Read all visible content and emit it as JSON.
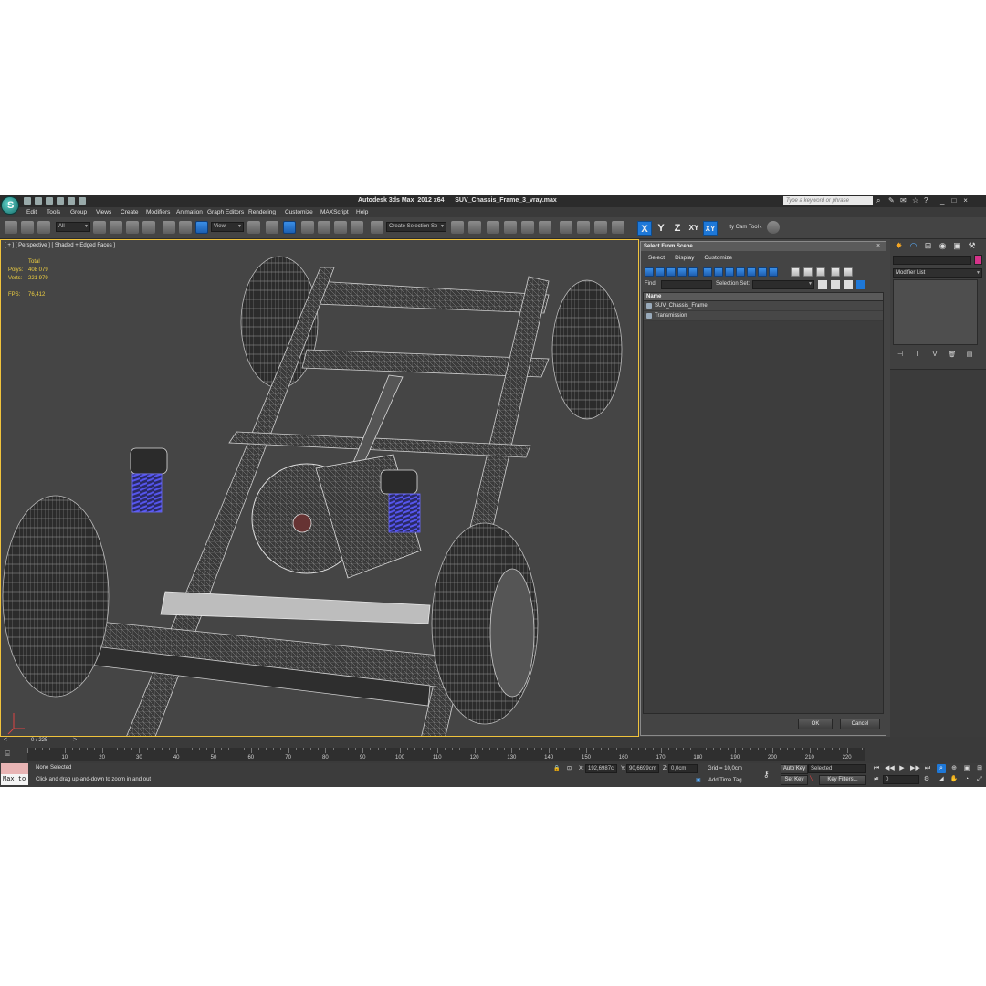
{
  "title": {
    "app_name": "Autodesk 3ds Max  2012 x64",
    "file_name": "SUV_Chassis_Frame_3_vray.max",
    "search_placeholder": "Type a keyword or phrase"
  },
  "menu": [
    "Edit",
    "Tools",
    "Group",
    "Views",
    "Create",
    "Modifiers",
    "Animation",
    "Graph Editors",
    "Rendering",
    "Customize",
    "MAXScript",
    "Help"
  ],
  "toolbar": {
    "selection_filter": "All",
    "ref_coord": "View",
    "named_selection": "Create Selection Se",
    "axes": [
      "X",
      "Y",
      "Z",
      "XY",
      "XY"
    ],
    "tool_label": "ity Cam Tool ‹"
  },
  "viewport": {
    "label": "[ + ] [ Perspective ] [ Shaded + Edged Faces ]",
    "stats": {
      "total_label": "Total",
      "polys_label": "Polys:",
      "polys_value": "408 079",
      "verts_label": "Verts:",
      "verts_value": "221 979",
      "fps_label": "FPS:",
      "fps_value": "76,412"
    }
  },
  "select_dialog": {
    "title": "Select From Scene",
    "menu": [
      "Select",
      "Display",
      "Customize"
    ],
    "find_label": "Find:",
    "selection_set_label": "Selection Set:",
    "column_header": "Name",
    "rows": [
      "SUV_Chassis_Frame",
      "Transmission"
    ],
    "ok_label": "OK",
    "cancel_label": "Cancel"
  },
  "command_panel": {
    "modifier_list": "Modifier List",
    "object_color": "#d6338a"
  },
  "timeline": {
    "frame_label": "0 / 225",
    "ticks": [
      10,
      20,
      30,
      40,
      50,
      60,
      70,
      80,
      90,
      100,
      110,
      120,
      130,
      140,
      150,
      160,
      170,
      180,
      190,
      200,
      210,
      220
    ]
  },
  "status": {
    "maxscript": "Max to",
    "selection": "None Selected",
    "prompt": "Click and drag up-and-down to zoom in and out",
    "x_label": "X:",
    "x_value": "192,6987c",
    "y_label": "Y:",
    "y_value": "90,6699cm",
    "z_label": "Z:",
    "z_value": "0,0cm",
    "grid": "Grid = 10,0cm",
    "add_time_tag": "Add Time Tag",
    "auto_key": "Auto Key",
    "set_key": "Set Key",
    "selected_dropdown": "Selected",
    "key_filters": "Key Filters...",
    "frame_field": "0"
  }
}
